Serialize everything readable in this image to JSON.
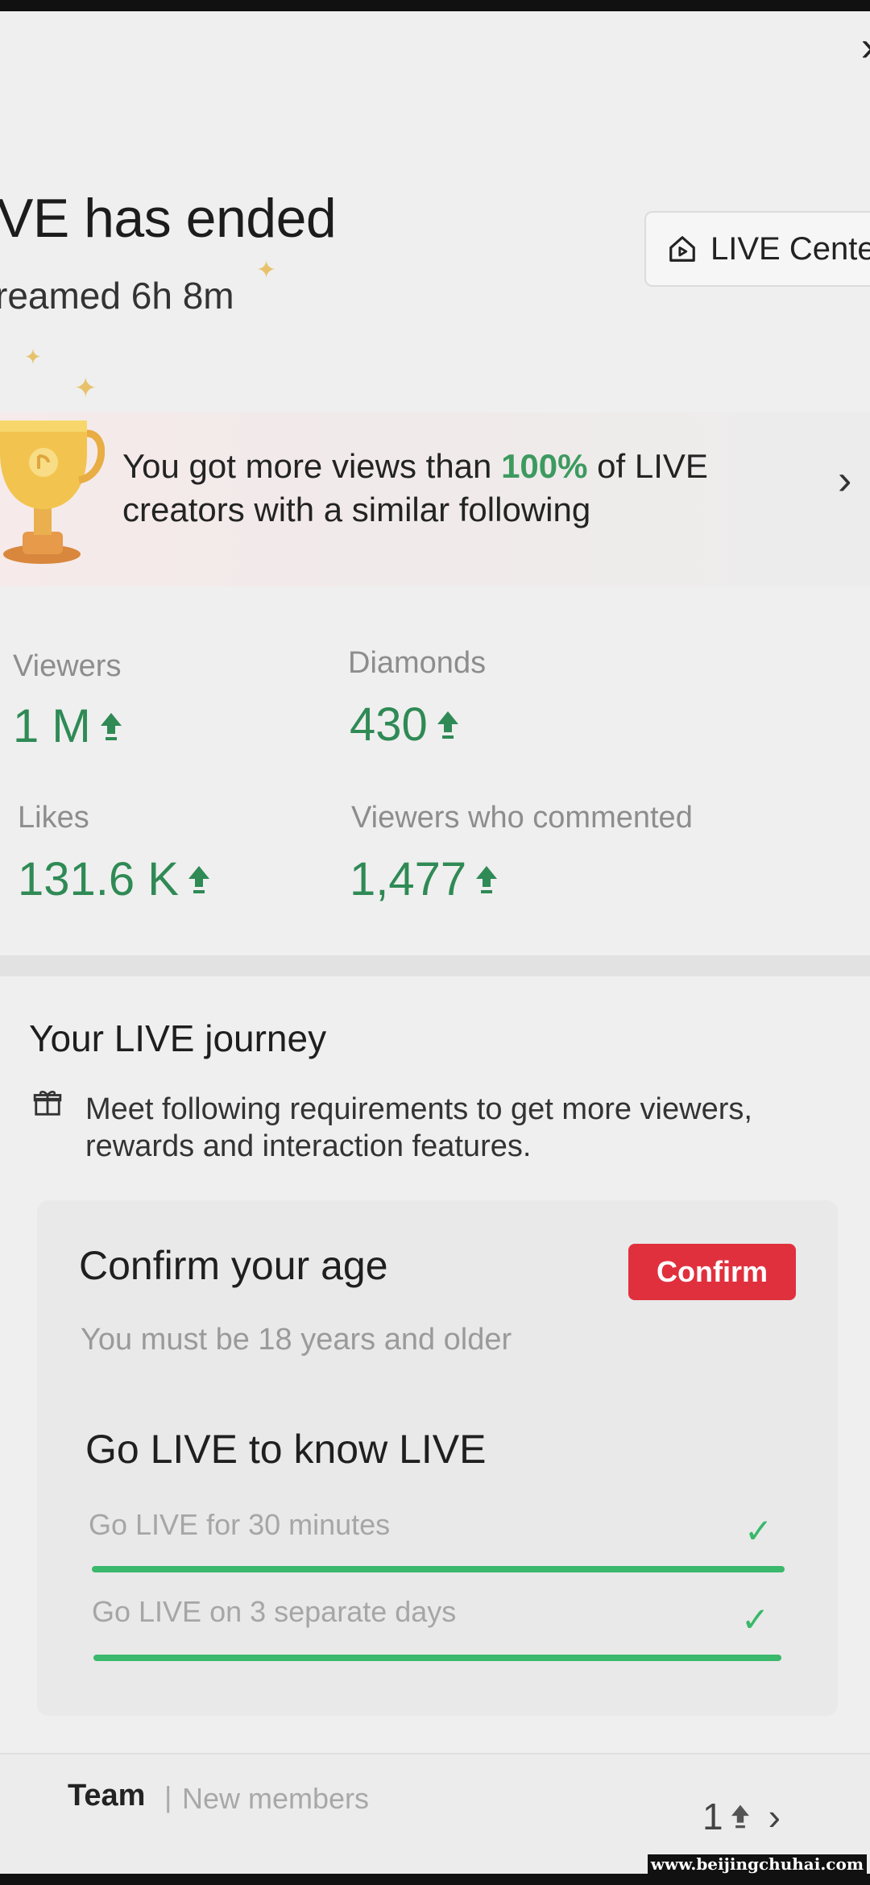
{
  "header": {
    "title": "VE has ended",
    "duration": "reamed 6h 8m",
    "close_icon": "close-icon",
    "live_center_label": "LIVE Cente",
    "live_center_icon": "house-icon"
  },
  "banner": {
    "text_before": "You got more views than ",
    "highlight": "100%",
    "text_after": " of LIVE creators with a similar following",
    "icon": "trophy-icon",
    "highlight_color": "#3d9a5f"
  },
  "stats": [
    {
      "label": "Viewers",
      "value": "1 M"
    },
    {
      "label": "Diamonds",
      "value": "430"
    },
    {
      "label": "Likes",
      "value": "131.6 K"
    },
    {
      "label": "Viewers who commented",
      "value": "1,477"
    }
  ],
  "journey": {
    "title": "Your LIVE journey",
    "description": "Meet following requirements to get more viewers, rewards and interaction features.",
    "age": {
      "title": "Confirm your age",
      "subtitle": "You must be 18 years and older",
      "button_label": "Confirm",
      "button_color": "#e0303e"
    },
    "goal": {
      "title": "Go LIVE to know LIVE",
      "requirements": [
        {
          "label": "Go LIVE for 30 minutes",
          "progress": 1.0,
          "done": true
        },
        {
          "label": "Go LIVE on 3 separate days",
          "progress": 1.0,
          "done": true
        }
      ]
    }
  },
  "team": {
    "label": "Team",
    "separator": "|",
    "sublabel": "New members",
    "count": "1"
  },
  "watermark": "www.beijingchuhai.com",
  "colors": {
    "accent_green": "#2f8a55",
    "progress_green": "#3ab86b",
    "confirm_red": "#e0303e"
  }
}
